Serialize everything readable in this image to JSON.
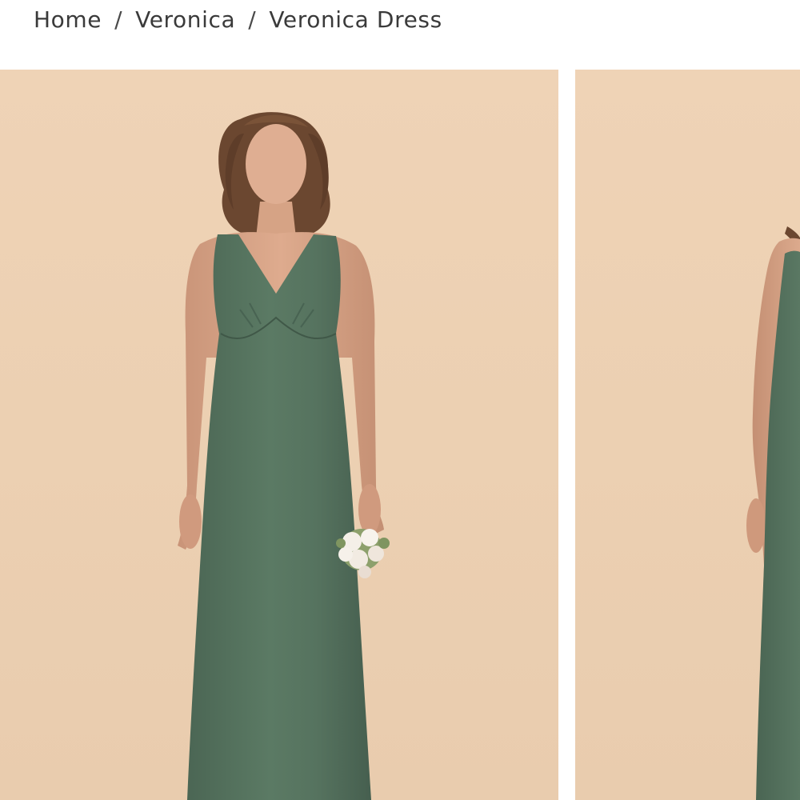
{
  "breadcrumb": {
    "items": [
      {
        "label": "Home"
      },
      {
        "label": "Veronica"
      },
      {
        "label": "Veronica Dress"
      }
    ],
    "separator": "/"
  },
  "gallery": {
    "images": [
      {
        "subject": "model wearing green satin v-neck maxi dress holding white bouquet, front view"
      },
      {
        "subject": "model wearing green satin maxi dress, side view"
      }
    ]
  },
  "colors": {
    "background": "#efd3b6",
    "dress": "#56735f",
    "text": "#3a3a3a"
  }
}
